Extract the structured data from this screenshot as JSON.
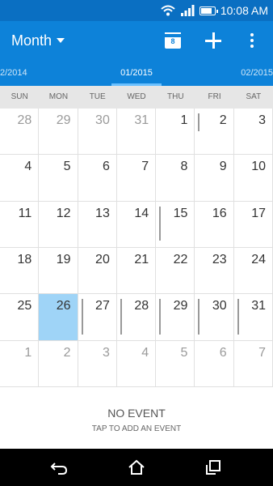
{
  "status_bar": {
    "time": "10:08 AM",
    "icons": [
      "wifi-icon",
      "signal-icon",
      "battery-icon"
    ],
    "battery_level": 0.85
  },
  "app_bar": {
    "view_label": "Month",
    "today_day": "8",
    "actions": [
      "today-icon",
      "add-icon",
      "more-icon"
    ]
  },
  "months": {
    "prev": "2/2014",
    "current": "01/2015",
    "next": "02/2015"
  },
  "weekdays": [
    "SUN",
    "MON",
    "TUE",
    "WED",
    "THU",
    "FRI",
    "SAT"
  ],
  "weeks": [
    [
      {
        "day": "28",
        "muted": true
      },
      {
        "day": "29",
        "muted": true
      },
      {
        "day": "30",
        "muted": true
      },
      {
        "day": "31",
        "muted": true
      },
      {
        "day": "1"
      },
      {
        "day": "2",
        "event": "bar-top"
      },
      {
        "day": "3"
      }
    ],
    [
      {
        "day": "4"
      },
      {
        "day": "5"
      },
      {
        "day": "6"
      },
      {
        "day": "7"
      },
      {
        "day": "8"
      },
      {
        "day": "9"
      },
      {
        "day": "10"
      }
    ],
    [
      {
        "day": "11"
      },
      {
        "day": "12"
      },
      {
        "day": "13"
      },
      {
        "day": "14"
      },
      {
        "day": "15",
        "event": "bar-mid"
      },
      {
        "day": "16"
      },
      {
        "day": "17"
      }
    ],
    [
      {
        "day": "18"
      },
      {
        "day": "19"
      },
      {
        "day": "20"
      },
      {
        "day": "21"
      },
      {
        "day": "22"
      },
      {
        "day": "23"
      },
      {
        "day": "24"
      }
    ],
    [
      {
        "day": "25"
      },
      {
        "day": "26",
        "selected": true
      },
      {
        "day": "27",
        "event": "bar-full"
      },
      {
        "day": "28",
        "event": "bar-full"
      },
      {
        "day": "29",
        "event": "bar-full"
      },
      {
        "day": "30",
        "event": "bar-full"
      },
      {
        "day": "31",
        "event": "bar-full"
      }
    ],
    [
      {
        "day": "1",
        "muted": true
      },
      {
        "day": "2",
        "muted": true
      },
      {
        "day": "3",
        "muted": true
      },
      {
        "day": "4",
        "muted": true
      },
      {
        "day": "5",
        "muted": true
      },
      {
        "day": "6",
        "muted": true
      },
      {
        "day": "7",
        "muted": true
      }
    ]
  ],
  "empty_state": {
    "title": "NO EVENT",
    "hint": "TAP TO ADD AN EVENT"
  },
  "nav": [
    "back-icon",
    "home-icon",
    "recent-apps-icon"
  ],
  "colors": {
    "status_bar": "#0a6fc2",
    "app_bar": "#0d82d9",
    "selected_day": "#9fd4f7",
    "indicator": "#6ac0ff"
  }
}
